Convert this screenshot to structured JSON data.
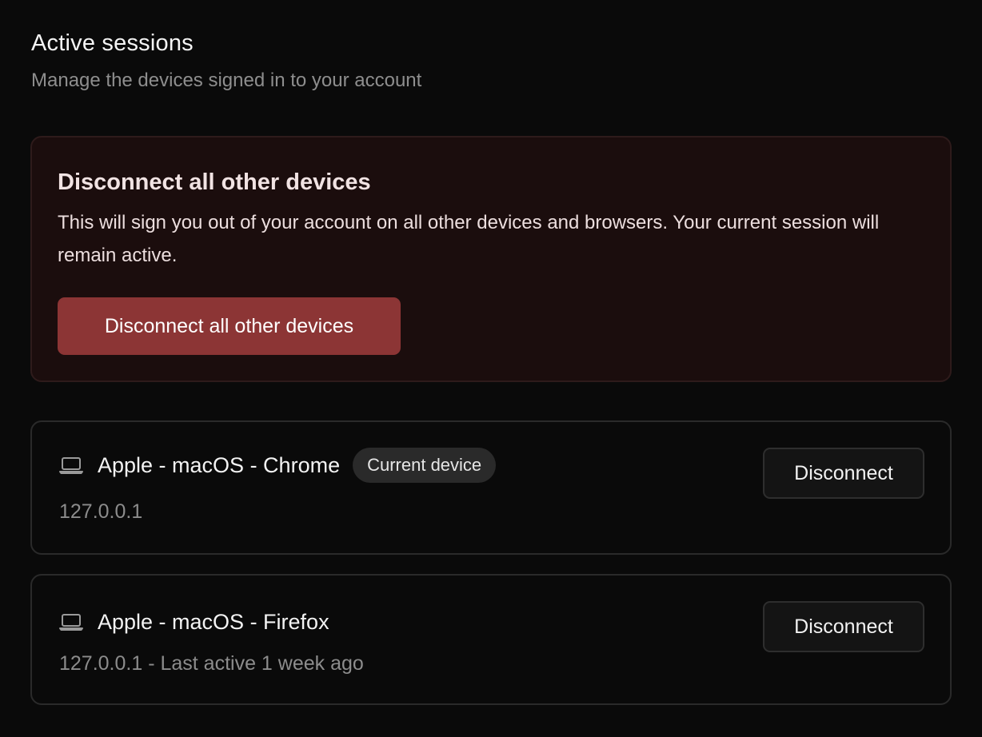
{
  "header": {
    "title": "Active sessions",
    "subtitle": "Manage the devices signed in to your account"
  },
  "danger_zone": {
    "title": "Disconnect all other devices",
    "description": "This will sign you out of your account on all other devices and browsers. Your current session will remain active.",
    "button_label": "Disconnect all other devices",
    "accent_color": "#8c3535"
  },
  "sessions": [
    {
      "icon": "laptop-icon",
      "device": "Apple - macOS - Chrome",
      "badge": "Current device",
      "meta": "127.0.0.1",
      "button_label": "Disconnect"
    },
    {
      "icon": "laptop-icon",
      "device": "Apple - macOS - Firefox",
      "meta": "127.0.0.1 - Last active 1 week ago",
      "button_label": "Disconnect"
    }
  ]
}
